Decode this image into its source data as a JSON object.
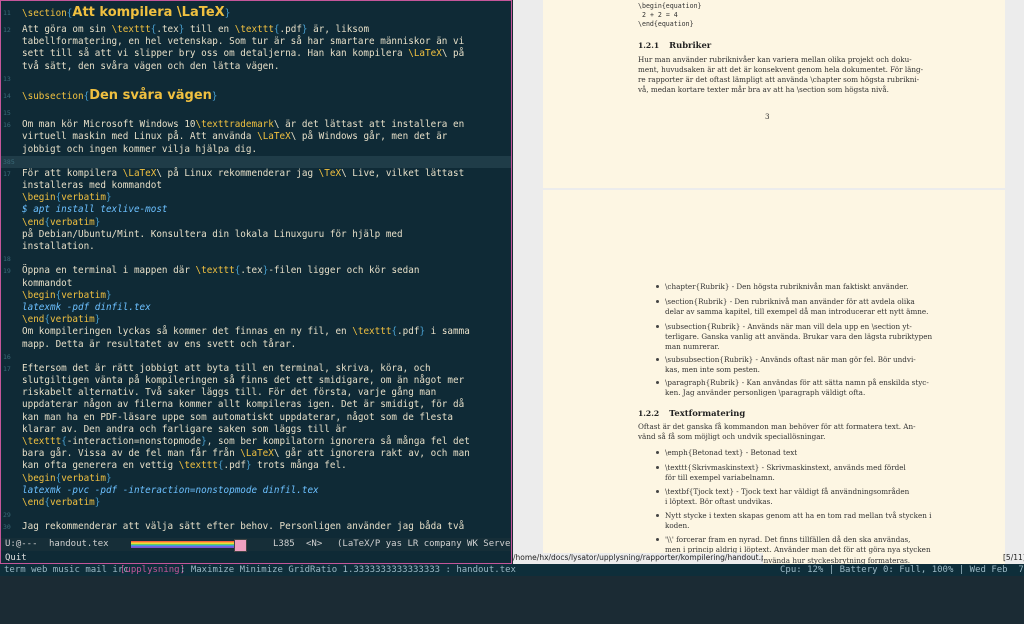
{
  "emacs": {
    "lines": [
      {
        "n": "11",
        "segs": [
          {
            "c": "kw",
            "t": "\\section"
          },
          {
            "c": "br",
            "t": "{"
          },
          {
            "c": "sec",
            "t": "Att kompilera \\LaTeX"
          },
          {
            "c": "br",
            "t": "}"
          }
        ],
        "big": true
      },
      {
        "n": "12",
        "segs": [
          {
            "c": "plain",
            "t": "Att göra om sin "
          },
          {
            "c": "kw",
            "t": "\\texttt"
          },
          {
            "c": "br",
            "t": "{"
          },
          {
            "c": "plain",
            "t": ".tex"
          },
          {
            "c": "br",
            "t": "}"
          },
          {
            "c": "plain",
            "t": " till en "
          },
          {
            "c": "kw",
            "t": "\\texttt"
          },
          {
            "c": "br",
            "t": "{"
          },
          {
            "c": "plain",
            "t": ".pdf"
          },
          {
            "c": "br",
            "t": "}"
          },
          {
            "c": "plain",
            "t": " är, liksom"
          }
        ]
      },
      {
        "n": "",
        "segs": [
          {
            "c": "plain",
            "t": "tabellformatering, en hel vetenskap. Som tur är så har smartare människor än vi"
          }
        ]
      },
      {
        "n": "",
        "segs": [
          {
            "c": "plain",
            "t": "sett till så att vi slipper bry oss om detaljerna. Han kan kompilera "
          },
          {
            "c": "kw",
            "t": "\\LaTeX"
          },
          {
            "c": "plain",
            "t": "\\ på"
          }
        ]
      },
      {
        "n": "",
        "segs": [
          {
            "c": "plain",
            "t": "två sätt, den svåra vägen och den lätta vägen."
          }
        ]
      },
      {
        "n": "13",
        "segs": []
      },
      {
        "n": "14",
        "segs": [
          {
            "c": "kw",
            "t": "\\subsection"
          },
          {
            "c": "br",
            "t": "{"
          },
          {
            "c": "sec",
            "t": "Den svåra vägen"
          },
          {
            "c": "br",
            "t": "}"
          }
        ],
        "big": true
      },
      {
        "n": "15",
        "segs": []
      },
      {
        "n": "16",
        "segs": [
          {
            "c": "plain",
            "t": "Om man kör Microsoft Windows 10"
          },
          {
            "c": "kw",
            "t": "\\texttrademark"
          },
          {
            "c": "plain",
            "t": "\\ är det lättast att installera en"
          }
        ]
      },
      {
        "n": "",
        "segs": [
          {
            "c": "plain",
            "t": "virtuell maskin med Linux på. Att använda "
          },
          {
            "c": "kw",
            "t": "\\LaTeX"
          },
          {
            "c": "plain",
            "t": "\\ på Windows går, men det är"
          }
        ]
      },
      {
        "n": "",
        "segs": [
          {
            "c": "plain",
            "t": "jobbigt och ingen kommer vilja hjälpa dig."
          }
        ]
      },
      {
        "n": "385",
        "segs": [],
        "cur": true
      },
      {
        "n": "17",
        "segs": [
          {
            "c": "plain",
            "t": "För att kompilera "
          },
          {
            "c": "kw",
            "t": "\\LaTeX"
          },
          {
            "c": "plain",
            "t": "\\ på Linux rekommenderar jag "
          },
          {
            "c": "kw",
            "t": "\\TeX"
          },
          {
            "c": "plain",
            "t": "\\ Live, vilket lättast"
          }
        ]
      },
      {
        "n": "",
        "segs": [
          {
            "c": "plain",
            "t": "installeras med kommandot"
          }
        ]
      },
      {
        "n": "",
        "segs": [
          {
            "c": "kw",
            "t": "\\begin"
          },
          {
            "c": "br",
            "t": "{"
          },
          {
            "c": "kw",
            "t": "verbatim"
          },
          {
            "c": "br",
            "t": "}"
          }
        ]
      },
      {
        "n": "",
        "segs": [
          {
            "c": "verb",
            "t": "$ apt install texlive-most"
          }
        ]
      },
      {
        "n": "",
        "segs": [
          {
            "c": "kw",
            "t": "\\end"
          },
          {
            "c": "br",
            "t": "{"
          },
          {
            "c": "kw",
            "t": "verbatim"
          },
          {
            "c": "br",
            "t": "}"
          }
        ]
      },
      {
        "n": "",
        "segs": [
          {
            "c": "plain",
            "t": "på Debian/Ubuntu/Mint. Konsultera din lokala Linuxguru för hjälp med"
          }
        ]
      },
      {
        "n": "",
        "segs": [
          {
            "c": "plain",
            "t": "installation."
          }
        ]
      },
      {
        "n": "18",
        "segs": []
      },
      {
        "n": "19",
        "segs": [
          {
            "c": "plain",
            "t": "Öppna en terminal i mappen där "
          },
          {
            "c": "kw",
            "t": "\\texttt"
          },
          {
            "c": "br",
            "t": "{"
          },
          {
            "c": "plain",
            "t": ".tex"
          },
          {
            "c": "br",
            "t": "}"
          },
          {
            "c": "plain",
            "t": "-filen ligger och kör sedan"
          }
        ]
      },
      {
        "n": "",
        "segs": [
          {
            "c": "plain",
            "t": "kommandot"
          }
        ]
      },
      {
        "n": "",
        "segs": [
          {
            "c": "kw",
            "t": "\\begin"
          },
          {
            "c": "br",
            "t": "{"
          },
          {
            "c": "kw",
            "t": "verbatim"
          },
          {
            "c": "br",
            "t": "}"
          }
        ]
      },
      {
        "n": "",
        "segs": [
          {
            "c": "verb",
            "t": "latexmk -pdf dinfil.tex"
          }
        ]
      },
      {
        "n": "",
        "segs": [
          {
            "c": "kw",
            "t": "\\end"
          },
          {
            "c": "br",
            "t": "{"
          },
          {
            "c": "kw",
            "t": "verbatim"
          },
          {
            "c": "br",
            "t": "}"
          }
        ]
      },
      {
        "n": "",
        "segs": [
          {
            "c": "plain",
            "t": "Om kompileringen lyckas så kommer det finnas en ny fil, en "
          },
          {
            "c": "kw",
            "t": "\\texttt"
          },
          {
            "c": "br",
            "t": "{"
          },
          {
            "c": "plain",
            "t": ".pdf"
          },
          {
            "c": "br",
            "t": "}"
          },
          {
            "c": "plain",
            "t": " i samma"
          }
        ]
      },
      {
        "n": "",
        "segs": [
          {
            "c": "plain",
            "t": "mapp. Detta är resultatet av ens svett och tårar."
          }
        ]
      },
      {
        "n": "16",
        "segs": []
      },
      {
        "n": "17",
        "segs": [
          {
            "c": "plain",
            "t": "Eftersom det är rätt jobbigt att byta till en terminal, skriva, köra, och"
          }
        ]
      },
      {
        "n": "",
        "segs": [
          {
            "c": "plain",
            "t": "slutgiltigen vänta på kompileringen så finns det ett smidigare, om än något mer"
          }
        ]
      },
      {
        "n": "",
        "segs": [
          {
            "c": "plain",
            "t": "riskabelt alternativ. Två saker läggs till. För det första, varje gång man"
          }
        ]
      },
      {
        "n": "",
        "segs": [
          {
            "c": "plain",
            "t": "uppdaterar någon av filerna kommer allt kompileras igen. Det är smidigt, för då"
          }
        ]
      },
      {
        "n": "",
        "segs": [
          {
            "c": "plain",
            "t": "kan man ha en PDF-läsare uppe som automatiskt uppdaterar, något som de flesta"
          }
        ]
      },
      {
        "n": "",
        "segs": [
          {
            "c": "plain",
            "t": "klarar av. Den andra och farligare saken som läggs till är"
          }
        ]
      },
      {
        "n": "",
        "segs": [
          {
            "c": "kw",
            "t": "\\texttt"
          },
          {
            "c": "br",
            "t": "{"
          },
          {
            "c": "plain",
            "t": "-interaction=nonstopmode"
          },
          {
            "c": "br",
            "t": "}"
          },
          {
            "c": "plain",
            "t": ", som ber kompilatorn ignorera så många fel det"
          }
        ]
      },
      {
        "n": "",
        "segs": [
          {
            "c": "plain",
            "t": "bara går. Vissa av de fel man får från "
          },
          {
            "c": "kw",
            "t": "\\LaTeX"
          },
          {
            "c": "plain",
            "t": "\\ går att ignorera rakt av, och man"
          }
        ]
      },
      {
        "n": "",
        "segs": [
          {
            "c": "plain",
            "t": "kan ofta generera en vettig "
          },
          {
            "c": "kw",
            "t": "\\texttt"
          },
          {
            "c": "br",
            "t": "{"
          },
          {
            "c": "plain",
            "t": ".pdf"
          },
          {
            "c": "br",
            "t": "}"
          },
          {
            "c": "plain",
            "t": " trots många fel."
          }
        ]
      },
      {
        "n": "",
        "segs": [
          {
            "c": "kw",
            "t": "\\begin"
          },
          {
            "c": "br",
            "t": "{"
          },
          {
            "c": "kw",
            "t": "verbatim"
          },
          {
            "c": "br",
            "t": "}"
          }
        ]
      },
      {
        "n": "",
        "segs": [
          {
            "c": "verb",
            "t": "latexmk -pvc -pdf -interaction=nonstopmode dinfil.tex"
          }
        ]
      },
      {
        "n": "",
        "segs": [
          {
            "c": "kw",
            "t": "\\end"
          },
          {
            "c": "br",
            "t": "{"
          },
          {
            "c": "kw",
            "t": "verbatim"
          },
          {
            "c": "br",
            "t": "}"
          }
        ]
      },
      {
        "n": "29",
        "segs": []
      },
      {
        "n": "30",
        "segs": [
          {
            "c": "plain",
            "t": "Jag rekommenderar att välja sätt efter behov. Personligen använder jag båda två"
          }
        ]
      }
    ],
    "modeline": {
      "state": "U:@---",
      "buffer": "handout.tex",
      "position": "L385",
      "mode_tag": "<N>",
      "modes": "(LaTeX/P yas LR company WK Server"
    },
    "minibuffer": "Quit"
  },
  "pdf": {
    "page1": {
      "eq_begin": "\\begin{equation}",
      "eq_body": "2 + 2 = 4",
      "eq_end": "\\end{equation}",
      "sec_num": "1.2.1",
      "sec_title": "Rubriker",
      "para": [
        "Hur man använder rubriknivåer kan variera mellan olika projekt och doku-",
        "ment, huvudsaken är att det är konsekvent genom hela dokumentet. För läng-",
        "re rapporter är det oftast lämpligt att använda \\chapter som högsta rubrikni-",
        "vå, medan kortare texter mår bra av att ha \\section som högsta nivå."
      ],
      "page_num": "3"
    },
    "page2": {
      "bullets1": [
        [
          "\\chapter{Rubrik} - Den högsta rubriknivån man faktiskt använder."
        ],
        [
          "\\section{Rubrik} - Den rubriknivå man använder för att avdela olika",
          "delar av samma kapitel, till exempel då man introducerar ett nytt ämne."
        ],
        [
          "\\subsection{Rubrik} - Används när man vill dela upp en \\section yt-",
          "terligare. Ganska vanlig att använda. Brukar vara den lägsta rubriktypen",
          "man numrerar."
        ],
        [
          "\\subsubsection{Rubrik} - Används oftast när man gör fel. Bör undvi-",
          "kas, men inte som pesten."
        ],
        [
          "\\paragraph{Rubrik} - Kan användas för att sätta namn på enskilda styc-",
          "ken. Jag använder personligen \\paragraph väldigt ofta."
        ]
      ],
      "sec_num": "1.2.2",
      "sec_title": "Textformatering",
      "para": [
        "Oftast är det ganska få kommandon man behöver för att formatera text. An-",
        "vänd så få som möjligt och undvik speciallösningar."
      ],
      "bullets2": [
        [
          "\\emph{Betonad text} - Betonad text"
        ],
        [
          "\\texttt{Skrivmaskinstext} - Skrivmaskinstext, används med fördel",
          "för till exempel variabelnamn."
        ],
        [
          "\\textbf{Tjock text} - Tjock text har väldigt få användningsområden",
          "i löptext. Bör oftast undvikas."
        ],
        [
          "Nytt stycke i texten skapas genom att ha en tom rad mellan två stycken i",
          "koden."
        ],
        [
          "'\\\\' forcerar fram en nyrad. Det finns tillfällen då den ska användas,",
          "men i princip aldrig i löptext. Använder man det för att göra nya stycken"
        ]
      ],
      "last_partial": "så är det oftast bättre att använda hur styckesbrytning formateras."
    },
    "path": "/home/hx/docs/lysator/upplysning/rapporter/kompilering/handout.pdf",
    "page_count": "[5/11]"
  },
  "statusbar": {
    "workspaces": [
      "term",
      "web",
      "music",
      "mail",
      "irc"
    ],
    "active_workspace": "[upplysning]",
    "layout_info": ": Maximize Minimize GridRatio 1.3333333333333333 : handout.tex",
    "system": "Cpu: 12% | Battery 0: Full, 100% | Wed Feb  7 13:46"
  }
}
